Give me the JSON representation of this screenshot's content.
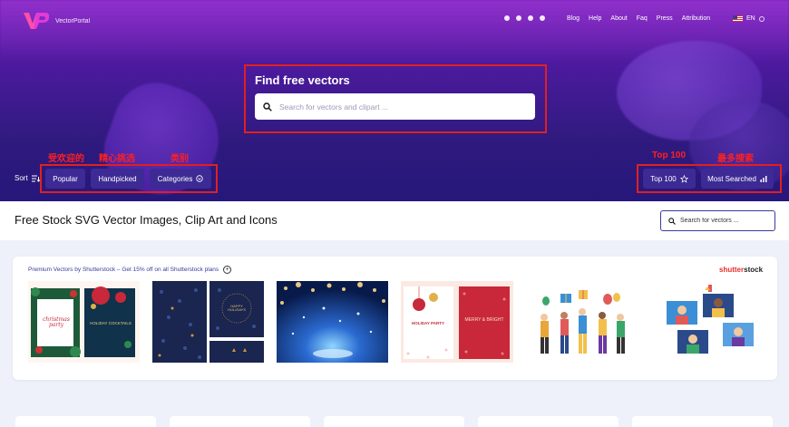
{
  "brand": {
    "name": "VectorPortal"
  },
  "social_icons": [
    "twitter-icon",
    "facebook-icon",
    "pinterest-icon",
    "dribbble-icon"
  ],
  "nav": [
    "Blog",
    "Help",
    "About",
    "Faq",
    "Press",
    "Attribution"
  ],
  "language": {
    "code": "EN"
  },
  "hero": {
    "title": "Find free vectors",
    "search_placeholder": "Search for vectors and clipart ..."
  },
  "annotations": {
    "popular_cn": "受欢迎的",
    "handpicked_cn": "精心挑选",
    "categories_cn": "类别",
    "top100": "Top 100",
    "most_searched_cn": "最多搜索"
  },
  "filters": {
    "sort_label": "Sort",
    "popular": "Popular",
    "handpicked": "Handpicked",
    "categories": "Categories",
    "top100": "Top 100",
    "most_searched": "Most Searched"
  },
  "header": {
    "title": "Free Stock SVG Vector Images, Clip Art and Icons",
    "search_placeholder": "Search for vectors ..."
  },
  "premium": {
    "text": "Premium Vectors by Shutterstock – Get 15% off on all Shutterstock plans",
    "plus": "+",
    "logo_a": "shutter",
    "logo_b": "stock"
  },
  "thumb_texts": {
    "christmas_party": "christmas party",
    "holiday_cocktails": "HOLIDAY COCKTAILS",
    "happy_holidays": "HAPPY HOLIDAYS",
    "holiday_party": "HOLIDAY PARTY",
    "merry_bright": "MERRY & BRIGHT"
  },
  "colors": {
    "accent": "#3b3aa0",
    "annotation": "#e02020",
    "chip": "#3d2a94"
  }
}
